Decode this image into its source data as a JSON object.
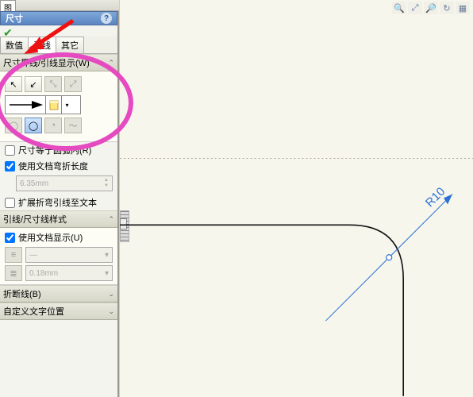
{
  "topstrip": {
    "tab": "图"
  },
  "panel": {
    "title": "尺寸",
    "tabs": {
      "value": "数值",
      "leader": "引线",
      "other": "其它"
    },
    "section_leader_display": "尺寸界线/引线显示(W)",
    "check_arc": "尺寸等于圆弧内(R)",
    "check_doc_length": "使用文档弯折长度",
    "bend_value": "6.35mm",
    "check_extend": "扩展折弯引线至文本",
    "section_leader_style": "引线/尺寸线样式",
    "check_doc_display": "使用文档显示(U)",
    "style_probe": "—",
    "style_thickness": "0.18mm",
    "section_break": "折断线(B)",
    "section_custom_text": "自定义文字位置"
  },
  "viewport": {
    "radius_label": "R10"
  }
}
